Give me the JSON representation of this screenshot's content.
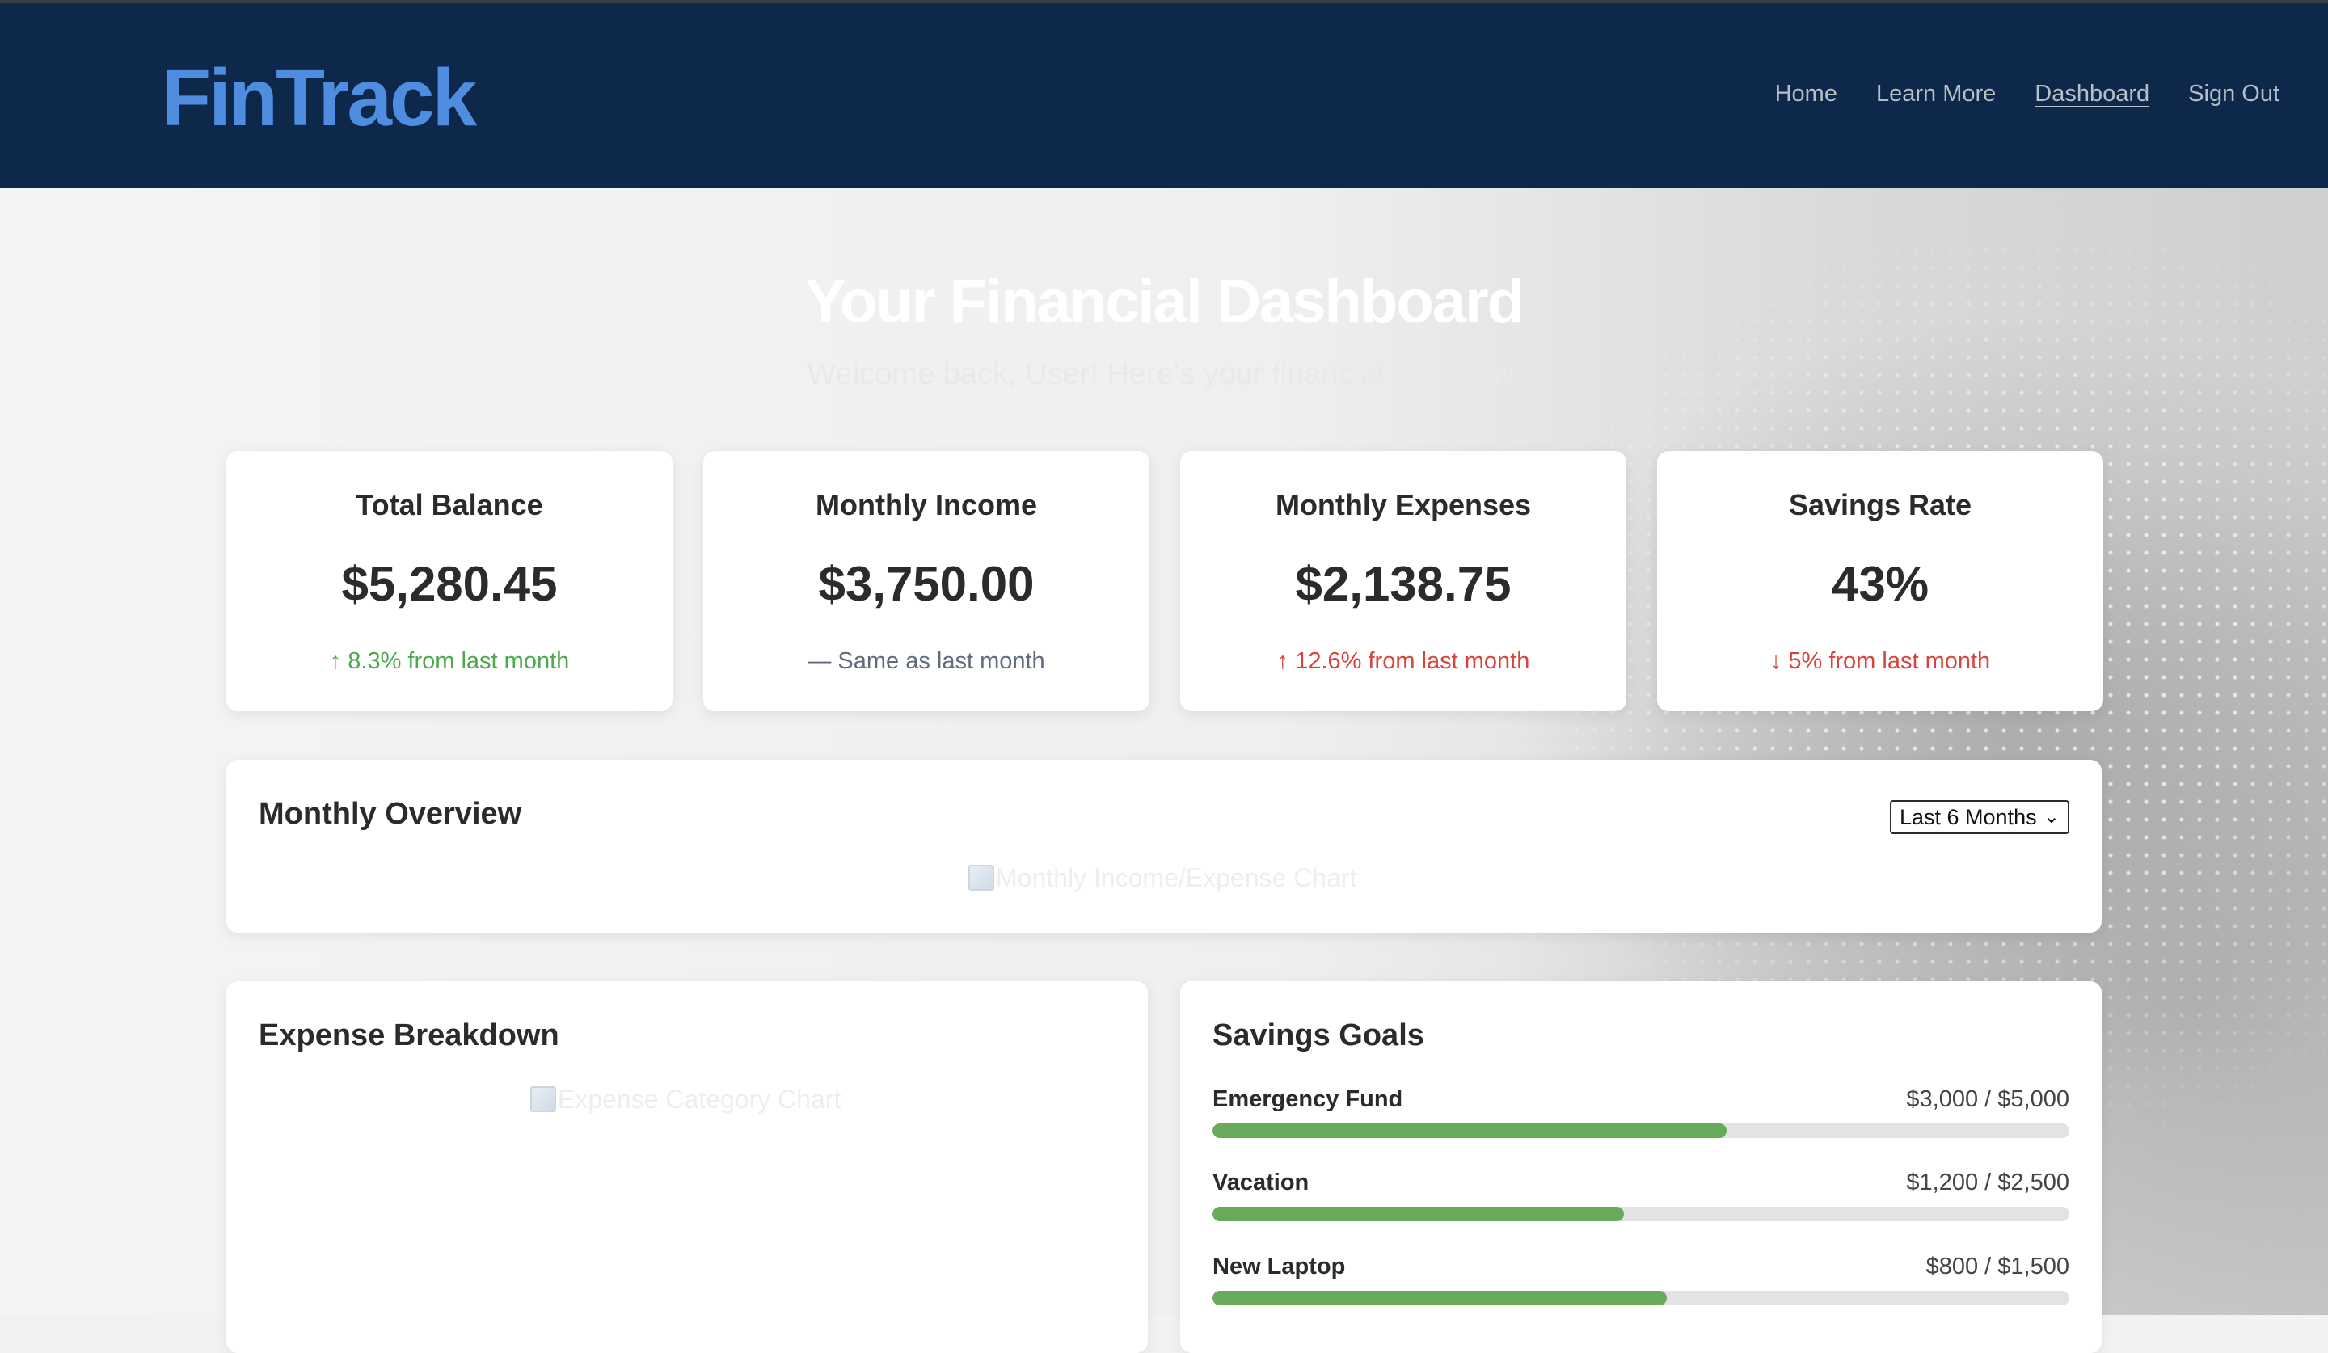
{
  "brand": "FinTrack",
  "nav": [
    {
      "label": "Home"
    },
    {
      "label": "Learn More"
    },
    {
      "label": "Dashboard"
    },
    {
      "label": "Sign Out"
    }
  ],
  "hero": {
    "title": "Your Financial Dashboard",
    "subtitle": "Welcome back, User! Here's your financial overview."
  },
  "stats": [
    {
      "label": "Total Balance",
      "value": "$5,280.45",
      "change": "↑ 8.3% from last month",
      "trend": "positive"
    },
    {
      "label": "Monthly Income",
      "value": "$3,750.00",
      "change": "— Same as last month",
      "trend": "neutral"
    },
    {
      "label": "Monthly Expenses",
      "value": "$2,138.75",
      "change": "↑ 12.6% from last month",
      "trend": "negative"
    },
    {
      "label": "Savings Rate",
      "value": "43%",
      "change": "↓ 5% from last month",
      "trend": "negative"
    }
  ],
  "overview": {
    "title": "Monthly Overview",
    "range_select": "Last 6 Months",
    "chart_alt": "Monthly Income/Expense Chart"
  },
  "expense_breakdown": {
    "title": "Expense Breakdown",
    "chart_alt": "Expense Category Chart"
  },
  "savings_goals": {
    "title": "Savings Goals",
    "goals": [
      {
        "name": "Emergency Fund",
        "amount": "$3,000 / $5,000",
        "progress": 0.6
      },
      {
        "name": "Vacation",
        "amount": "$1,200 / $2,500",
        "progress": 0.48
      },
      {
        "name": "New Laptop",
        "amount": "$800 / $1,500",
        "progress": 0.53
      }
    ]
  },
  "colors": {
    "header_bg": "#0d284a",
    "brand": "#4f8de0",
    "positive": "#4caa4c",
    "neutral": "#5f6b7a",
    "negative": "#d9433a",
    "progress": "#66aa5a"
  }
}
